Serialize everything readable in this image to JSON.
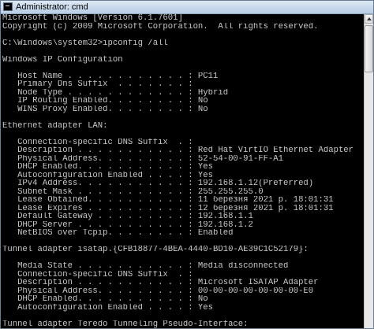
{
  "window": {
    "title": "Administrator: cmd"
  },
  "console": {
    "lines": [
      "Microsoft Windows [Version 6.1.7601]",
      "Copyright (c) 2009 Microsoft Corporation.  All rights reserved.",
      "",
      "C:\\Windows\\system32>ipconfig /all",
      "",
      "Windows IP Configuration",
      "",
      "   Host Name . . . . . . . . . . . . : PC11",
      "   Primary Dns Suffix  . . . . . . . :",
      "   Node Type . . . . . . . . . . . . : Hybrid",
      "   IP Routing Enabled. . . . . . . . : No",
      "   WINS Proxy Enabled. . . . . . . . : No",
      "",
      "Ethernet adapter LAN:",
      "",
      "   Connection-specific DNS Suffix  . :",
      "   Description . . . . . . . . . . . : Red Hat VirtIO Ethernet Adapter",
      "   Physical Address. . . . . . . . . : 52-54-00-91-FF-A1",
      "   DHCP Enabled. . . . . . . . . . . : Yes",
      "   Autoconfiguration Enabled . . . . : Yes",
      "   IPv4 Address. . . . . . . . . . . : 192.168.1.12(Preferred)",
      "   Subnet Mask . . . . . . . . . . . : 255.255.255.0",
      "   Lease Obtained. . . . . . . . . . : 11 березня 2021 p. 18:01:31",
      "   Lease Expires . . . . . . . . . . : 12 березня 2021 p. 18:01:31",
      "   Default Gateway . . . . . . . . . : 192.168.1.1",
      "   DHCP Server . . . . . . . . . . . : 192.168.1.2",
      "   NetBIOS over Tcpip. . . . . . . . : Enabled",
      "",
      "Tunnel adapter isatap.{CFB18877-4BEA-4440-BD10-AE39C1C52179}:",
      "",
      "   Media State . . . . . . . . . . . : Media disconnected",
      "   Connection-specific DNS Suffix  . :",
      "   Description . . . . . . . . . . . : Microsoft ISATAP Adapter",
      "   Physical Address. . . . . . . . . : 00-00-00-00-00-00-00-E0",
      "   DHCP Enabled. . . . . . . . . . . : No",
      "   Autoconfiguration Enabled . . . . : Yes",
      "",
      "Tunnel adapter Teredo Tunneling Pseudo-Interface:"
    ]
  },
  "icons": {
    "title": "cmd-console-icon",
    "scroll_up": "arrow-up-icon"
  },
  "colors": {
    "background": "#000000",
    "text": "#c8c8c8",
    "titlebar": "#c9d9ec"
  }
}
